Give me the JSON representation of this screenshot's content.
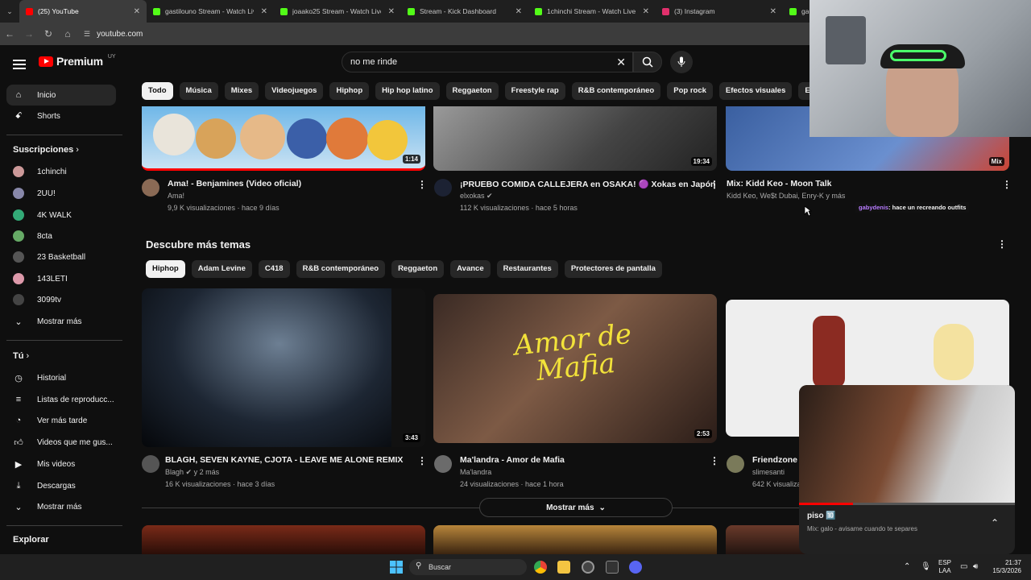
{
  "browser": {
    "tabs": [
      {
        "title": "(25) YouTube",
        "color": "#ff0000"
      },
      {
        "title": "gastilouno Stream - Watch Live",
        "color": "#53fc18"
      },
      {
        "title": "joaako25 Stream - Watch Live",
        "color": "#53fc18"
      },
      {
        "title": "Stream - Kick Dashboard",
        "color": "#53fc18"
      },
      {
        "title": "1chinchi Stream - Watch Live o",
        "color": "#53fc18"
      },
      {
        "title": "(3) Instagram",
        "color": "#e1306c"
      },
      {
        "title": "ga",
        "color": "#53fc18"
      }
    ],
    "url": "youtube.com"
  },
  "header": {
    "logo": "Premium",
    "region": "UY",
    "search_value": "no me rinde"
  },
  "chips": [
    "Todo",
    "Música",
    "Mixes",
    "Videojuegos",
    "Hiphop",
    "Hip hop latino",
    "Reggaeton",
    "Freestyle rap",
    "R&B contemporáneo",
    "Pop rock",
    "Efectos visuales",
    "En directo"
  ],
  "sidebar": {
    "home": "Inicio",
    "shorts": "Shorts",
    "subs_title": "Suscripciones",
    "subs": [
      {
        "name": "1chinchi",
        "color": "#c99"
      },
      {
        "name": "2UU!",
        "color": "#88a"
      },
      {
        "name": "4K WALK",
        "color": "#3a7"
      },
      {
        "name": "8cta",
        "color": "#6a6"
      },
      {
        "name": "23 Basketball",
        "color": "#555"
      },
      {
        "name": "143LETI",
        "color": "#d9a"
      },
      {
        "name": "3099tv",
        "color": "#444"
      }
    ],
    "subs_more": "Mostrar más",
    "you_title": "Tú",
    "you_items": [
      "Historial",
      "Listas de reproducc...",
      "Ver más tarde",
      "Videos que me gus...",
      "Mis videos",
      "Descargas",
      "Mostrar más"
    ],
    "explore": "Explorar"
  },
  "top_videos": [
    {
      "title": "Ama! - Benjamines (Video oficial)",
      "channel": "Ama!",
      "meta": "9,9 K visualizaciones · hace 9 días",
      "duration": "1:14"
    },
    {
      "title": "¡PRUEBO COMIDA CALLEJERA en OSAKA! 🟣 Xokas en Japón",
      "channel": "elxokas",
      "meta": "112 K visualizaciones · hace 5 horas",
      "duration": "19:34"
    },
    {
      "title": "Mix: Kidd Keo - Moon Talk",
      "channel": "Kidd Keo, We$t Dubai, Enry-K y más",
      "meta": "",
      "duration": "Mix"
    }
  ],
  "section": {
    "title": "Descubre más temas",
    "chips": [
      "Hiphop",
      "Adam Levine",
      "C418",
      "R&B contemporáneo",
      "Reggaeton",
      "Avance",
      "Restaurantes",
      "Protectores de pantalla"
    ]
  },
  "videos": [
    {
      "title": "BLAGH, SEVEN KAYNE, CJOTA  - LEAVE ME ALONE REMIX",
      "channel": "Blagh",
      "channel_extra": "y 2 más",
      "meta": "16 K visualizaciones · hace 3 días",
      "duration": "3:43"
    },
    {
      "title": "Ma'landra - Amor de Mafia",
      "channel": "Ma'landra",
      "meta": "24 visualizaciones · hace 1 hora",
      "duration": "2:53",
      "art_text": "Amor de Mafia"
    },
    {
      "title": "Friendzone :",
      "channel": "slimesanti",
      "meta": "642 K visualiza"
    }
  ],
  "show_more": "Mostrar más",
  "chat": {
    "user": "gabydenis",
    "text": ": hace un recreando outfits"
  },
  "miniplayer": {
    "title": "piso 🔟",
    "subtitle": "Mix: galo - avisame cuando te separes"
  },
  "taskbar": {
    "search": "Buscar",
    "lang": "ESP",
    "lang2": "LAA",
    "time": "21:37",
    "date": "15/3/2026"
  }
}
